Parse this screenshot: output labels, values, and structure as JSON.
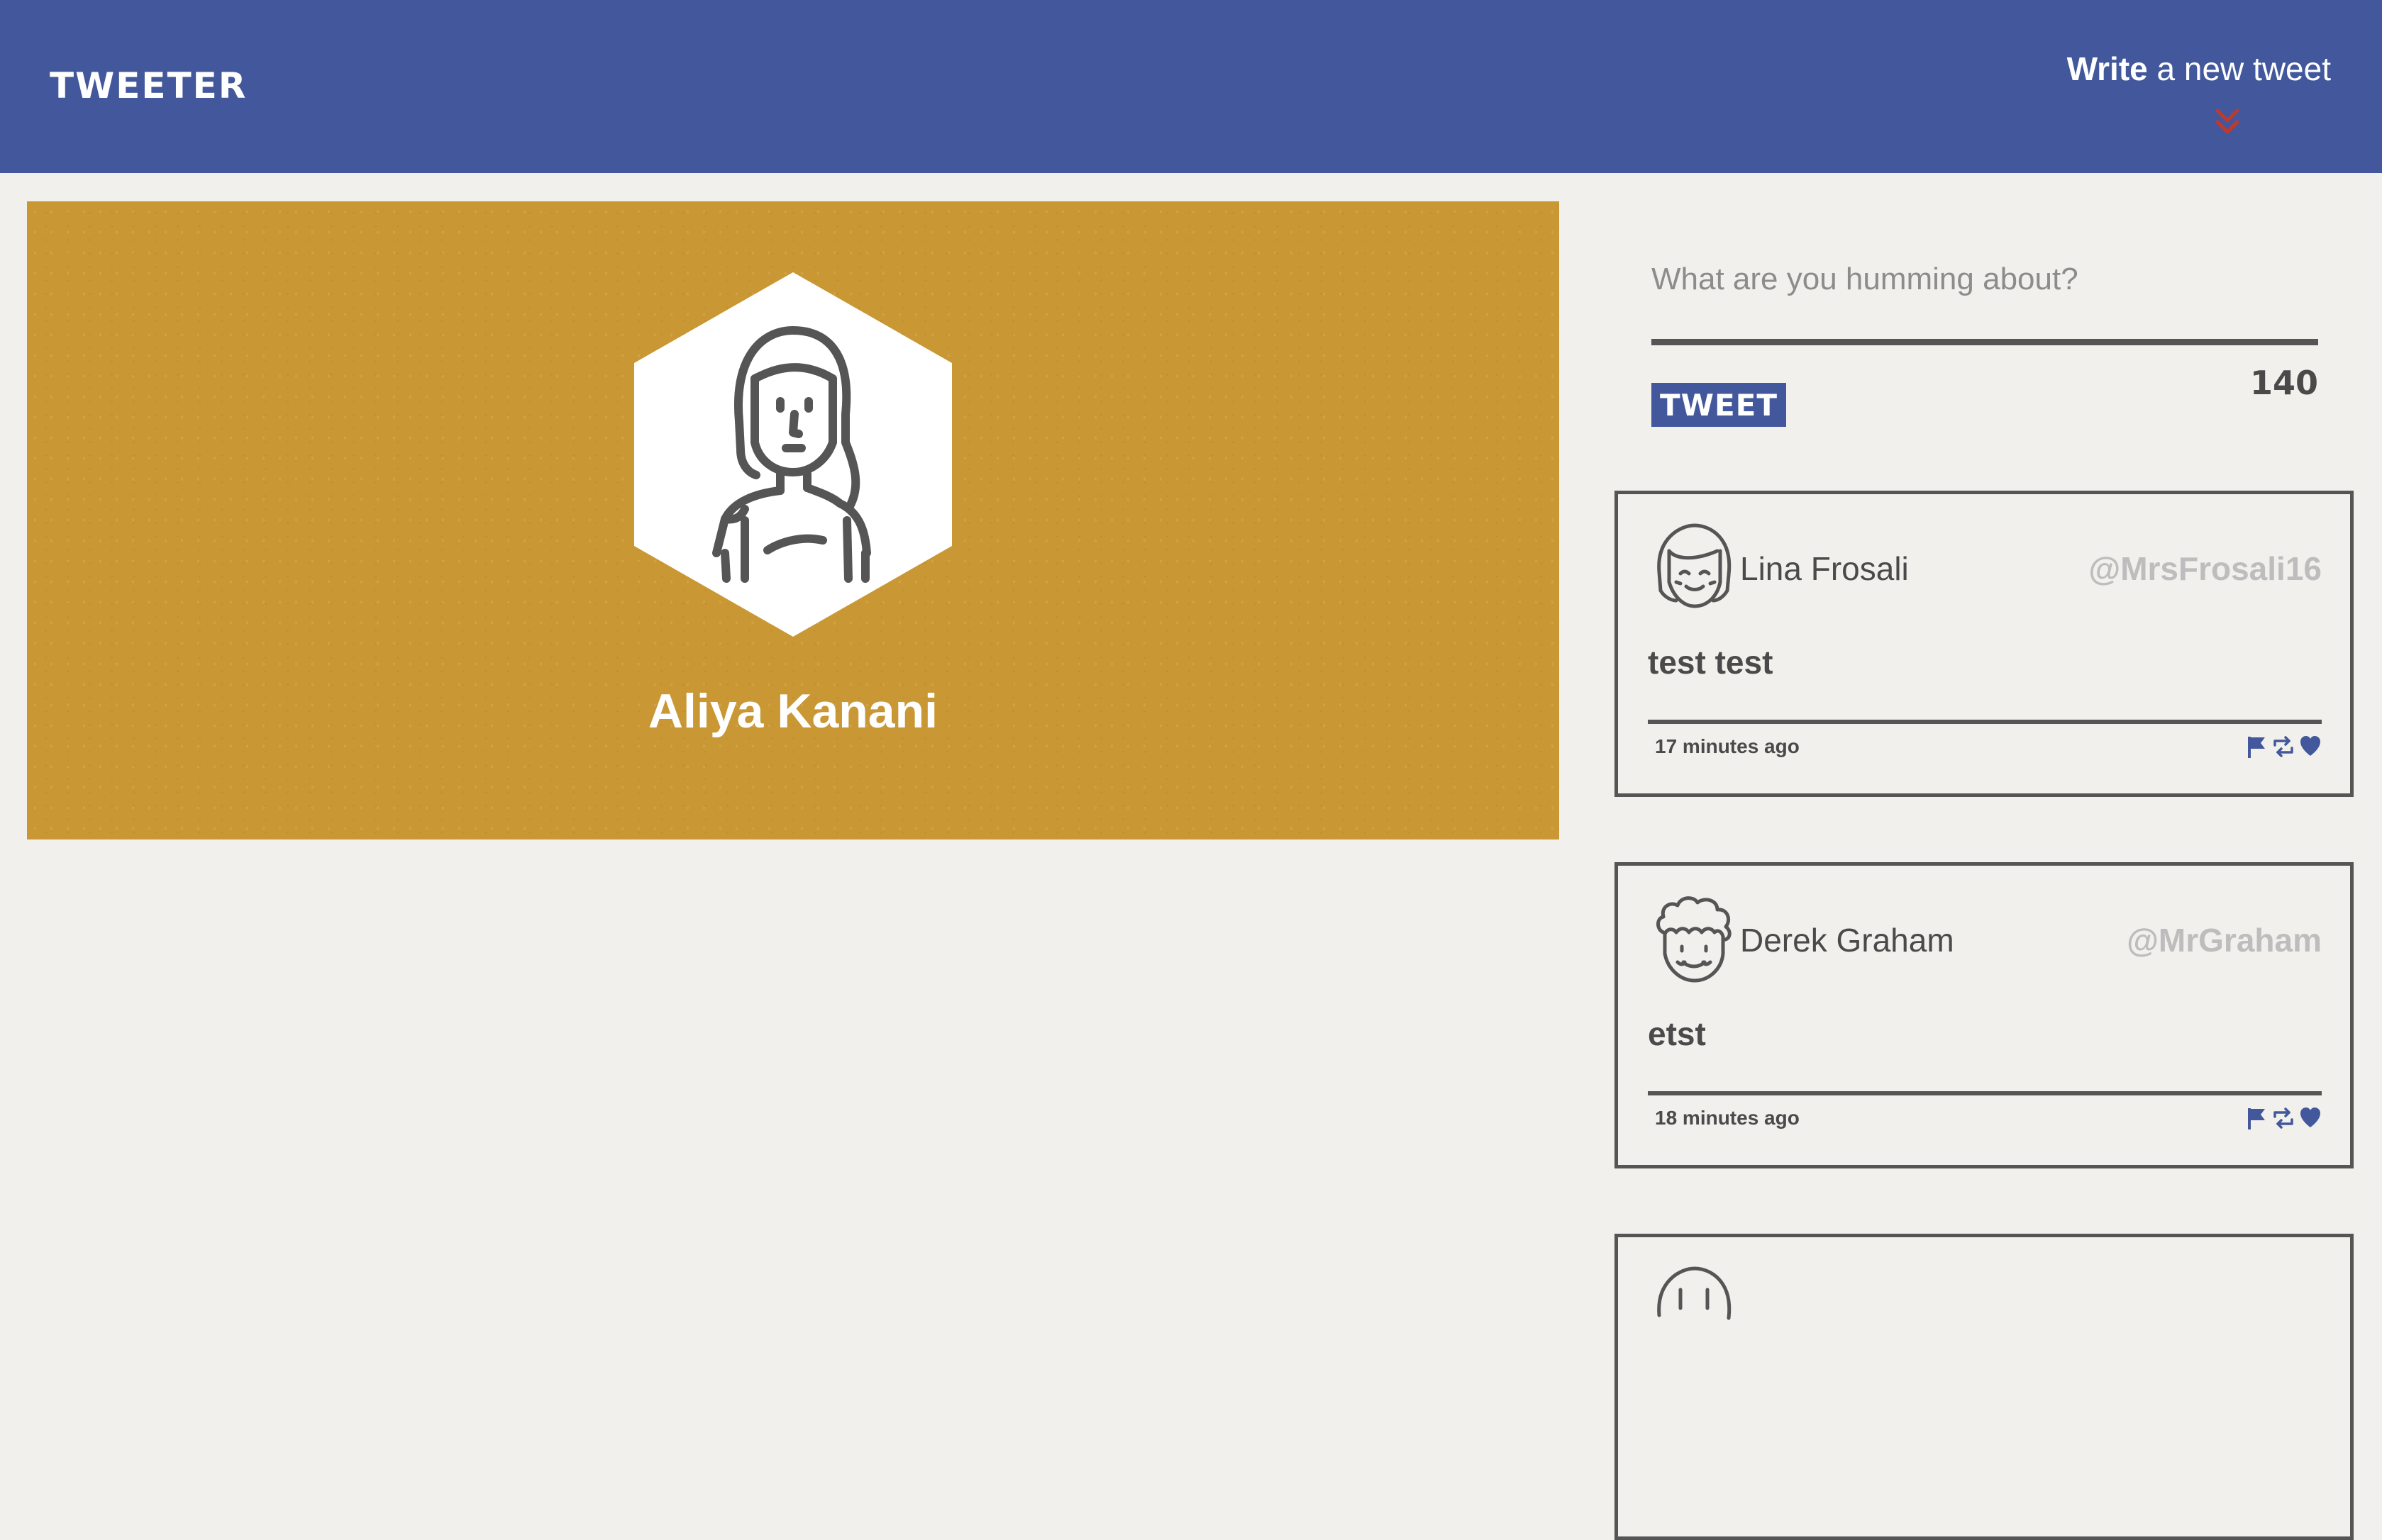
{
  "nav": {
    "brand": "TWEETER",
    "compose_bold": "Write",
    "compose_rest": " a new tweet",
    "compose_icon": "double-chevron-down-icon",
    "compose_icon_color": "#c0392b"
  },
  "profile": {
    "name": "Aliya Kanani",
    "avatar_icon": "woman-avatar-icon",
    "banner_color": "#c99733"
  },
  "composer": {
    "placeholder": "What are you humming about?",
    "value": "",
    "button_label": "TWEET",
    "counter": "140"
  },
  "tweets": [
    {
      "avatar_icon": "girl-avatar-icon",
      "author": "Lina Frosali",
      "handle": "@MrsFrosali16",
      "content": "test test",
      "time": "17 minutes ago"
    },
    {
      "avatar_icon": "curly-hair-man-avatar-icon",
      "author": "Derek Graham",
      "handle": "@MrGraham",
      "content": "etst",
      "time": "18 minutes ago"
    },
    {
      "avatar_icon": "avatar-icon",
      "author": "",
      "handle": "",
      "content": "",
      "time": ""
    }
  ],
  "colors": {
    "nav": "#43589c",
    "background": "#f1f0ec",
    "accent": "#43589c",
    "text": "#4a4a4a",
    "handle": "#bdbdbd"
  }
}
